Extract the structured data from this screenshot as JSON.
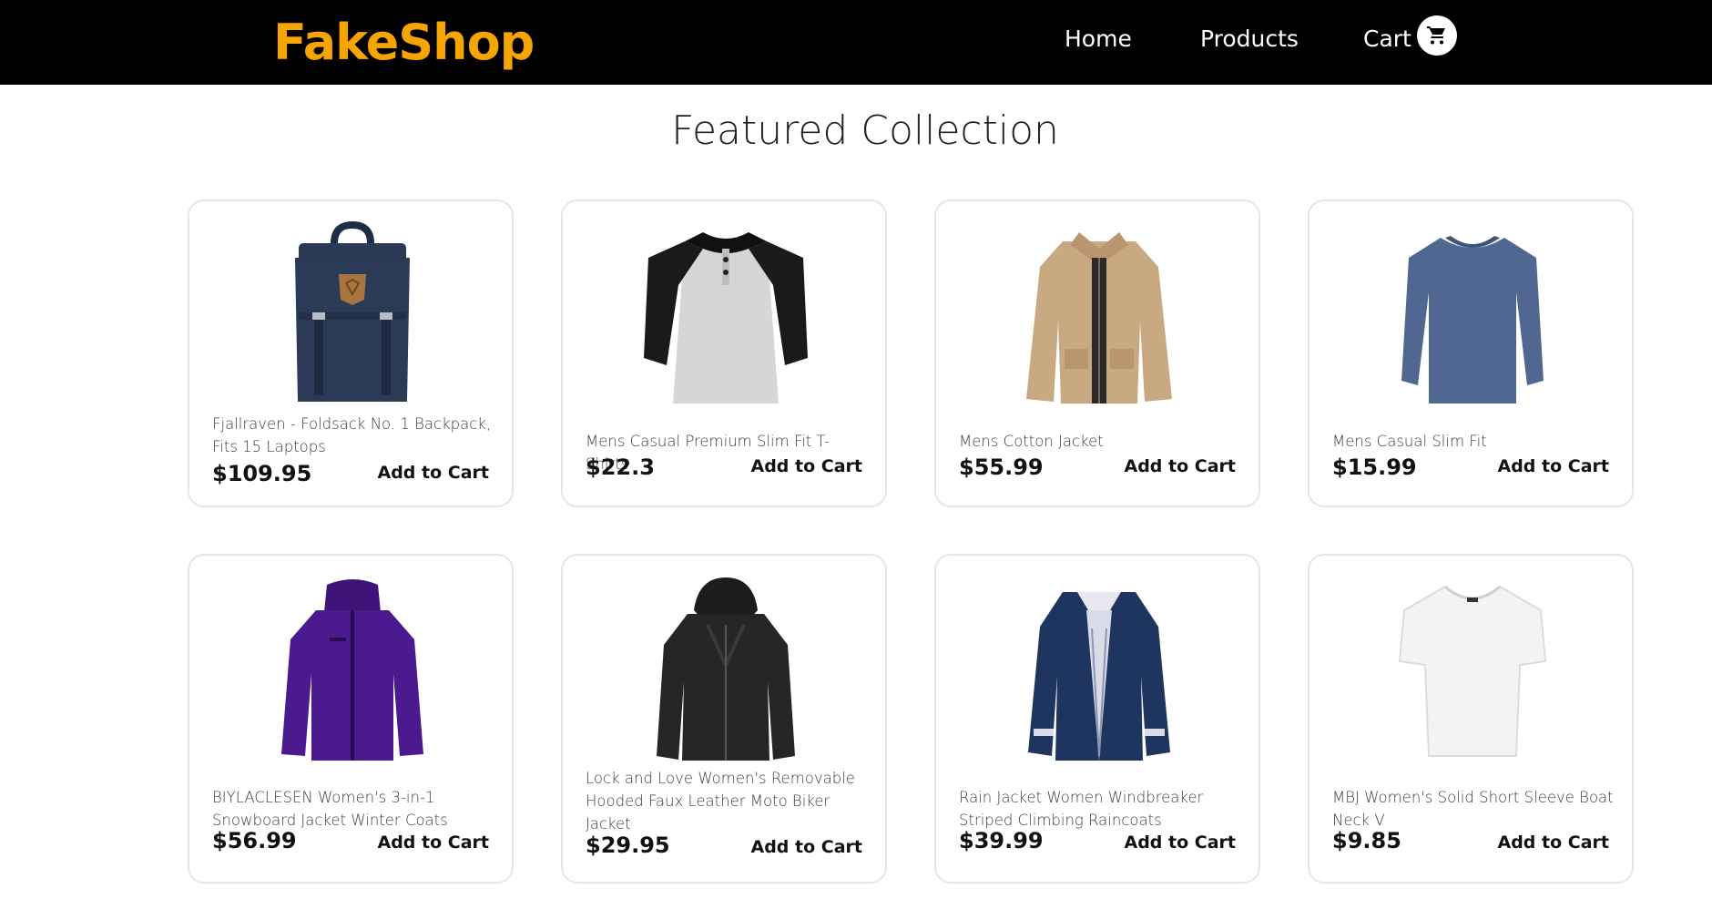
{
  "header": {
    "brand": "FakeShop",
    "nav": {
      "home": "Home",
      "products": "Products",
      "cart": "Cart"
    },
    "cart_icon": "shopping-cart-icon",
    "brand_color": "#f6a400",
    "background_color": "#000000"
  },
  "main": {
    "title": "Featured Collection",
    "add_to_cart_label": "Add to Cart",
    "products": [
      {
        "title": "Fjallraven - Foldsack No. 1 Backpack, Fits 15 Laptops",
        "price": "$109.95",
        "image": "backpack-image"
      },
      {
        "title": "Mens Casual Premium Slim Fit T-Shirts",
        "price": "$22.3",
        "image": "raglan-tshirt-image"
      },
      {
        "title": "Mens Cotton Jacket",
        "price": "$55.99",
        "image": "cotton-jacket-image"
      },
      {
        "title": "Mens Casual Slim Fit",
        "price": "$15.99",
        "image": "long-sleeve-shirt-image"
      },
      {
        "title": "BIYLACLESEN Women's 3-in-1 Snowboard Jacket Winter Coats",
        "price": "$56.99",
        "image": "snowboard-jacket-image"
      },
      {
        "title": "Lock and Love Women's Removable Hooded Faux Leather Moto Biker Jacket",
        "price": "$29.95",
        "image": "leather-jacket-image"
      },
      {
        "title": "Rain Jacket Women Windbreaker Striped Climbing Raincoats",
        "price": "$39.99",
        "image": "rain-jacket-image"
      },
      {
        "title": "MBJ Women's Solid Short Sleeve Boat Neck V",
        "price": "$9.85",
        "image": "white-top-image"
      }
    ]
  }
}
